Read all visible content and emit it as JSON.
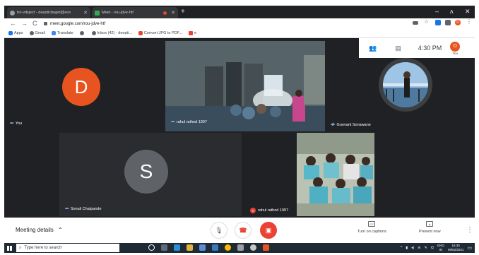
{
  "browser": {
    "tabs": [
      {
        "label": "tro-vdsjezt - deepticbuget@ece",
        "active": false
      },
      {
        "label": "Meet - rou-jdve-htf",
        "active": true
      }
    ],
    "new_tab": "+",
    "window_controls": {
      "minimize": "–",
      "restore": "ʌ",
      "close": "✕"
    },
    "nav": {
      "back": "←",
      "forward": "→",
      "reload": "C"
    },
    "url": "meet.google.com/rou-jdve-htf",
    "profile_initial": "D"
  },
  "bookmarks": [
    "Apps",
    "Gmail",
    "Translate",
    "",
    "Inbox (42) - deepti...",
    "Convert JPG to PDF...",
    "e"
  ],
  "meet": {
    "time": "4:30 PM",
    "you_label": "You",
    "you_initial": "D",
    "tiles": [
      {
        "name": "You",
        "initial": "D",
        "avatar_color": "#e8541f"
      },
      {
        "name": "rahul rathod 1997"
      },
      {
        "name": "Gunvant Sonawane"
      },
      {
        "name": "Sonali Chatpande",
        "initial": "S",
        "avatar_color": "#5f6368"
      },
      {
        "name": "rahul rathod 1997"
      }
    ]
  },
  "controls": {
    "meeting_details": "Meeting details",
    "captions_label": "Turn on captions",
    "captions_icon": "CC",
    "present_label": "Present now",
    "more": "⋮"
  },
  "taskbar": {
    "search_placeholder": "Type here to search",
    "language": "ENG",
    "region": "IN",
    "time": "16:30",
    "date": "09/02/2021"
  }
}
